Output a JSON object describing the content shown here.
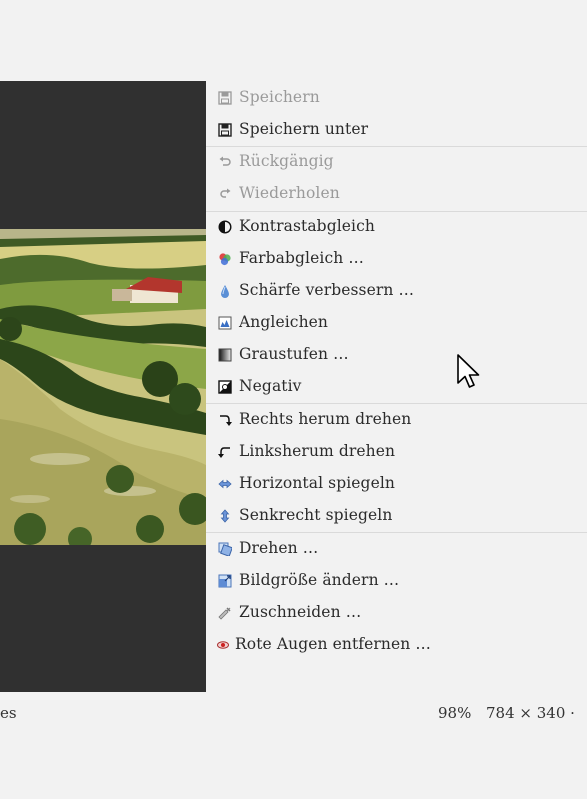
{
  "menu": {
    "items": [
      {
        "label": "Speichern",
        "icon": "save-icon",
        "disabled": true
      },
      {
        "label": "Speichern unter",
        "icon": "save-as-icon",
        "disabled": false
      },
      {
        "label": "Rückgängig",
        "icon": "undo-icon",
        "disabled": true
      },
      {
        "label": "Wiederholen",
        "icon": "redo-icon",
        "disabled": true
      },
      {
        "label": "Kontrastabgleich",
        "icon": "contrast-icon",
        "disabled": false
      },
      {
        "label": "Farbabgleich …",
        "icon": "color-balance-icon",
        "disabled": false
      },
      {
        "label": "Schärfe verbessern …",
        "icon": "sharpen-icon",
        "disabled": false
      },
      {
        "label": "Angleichen",
        "icon": "equalize-icon",
        "disabled": false
      },
      {
        "label": "Graustufen …",
        "icon": "grayscale-icon",
        "disabled": false
      },
      {
        "label": "Negativ",
        "icon": "negative-icon",
        "disabled": false
      },
      {
        "label": "Rechts herum drehen",
        "icon": "rotate-right-icon",
        "disabled": false
      },
      {
        "label": "Linksherum drehen",
        "icon": "rotate-left-icon",
        "disabled": false
      },
      {
        "label": "Horizontal spiegeln",
        "icon": "flip-horizontal-icon",
        "disabled": false
      },
      {
        "label": "Senkrecht spiegeln",
        "icon": "flip-vertical-icon",
        "disabled": false
      },
      {
        "label": "Drehen …",
        "icon": "rotate-icon",
        "disabled": false
      },
      {
        "label": "Bildgröße ändern …",
        "icon": "resize-icon",
        "disabled": false
      },
      {
        "label": "Zuschneiden …",
        "icon": "crop-icon",
        "disabled": false
      },
      {
        "label": "Rote Augen entfernen …",
        "icon": "red-eye-icon",
        "disabled": false
      }
    ]
  },
  "status": {
    "left_text": "es",
    "zoom": "98%",
    "dimensions": "784 × 340 ·"
  },
  "colors": {
    "viewer_background": "#303030",
    "menu_background": "#f2f2f2",
    "disabled_text": "#9a9a9a"
  }
}
